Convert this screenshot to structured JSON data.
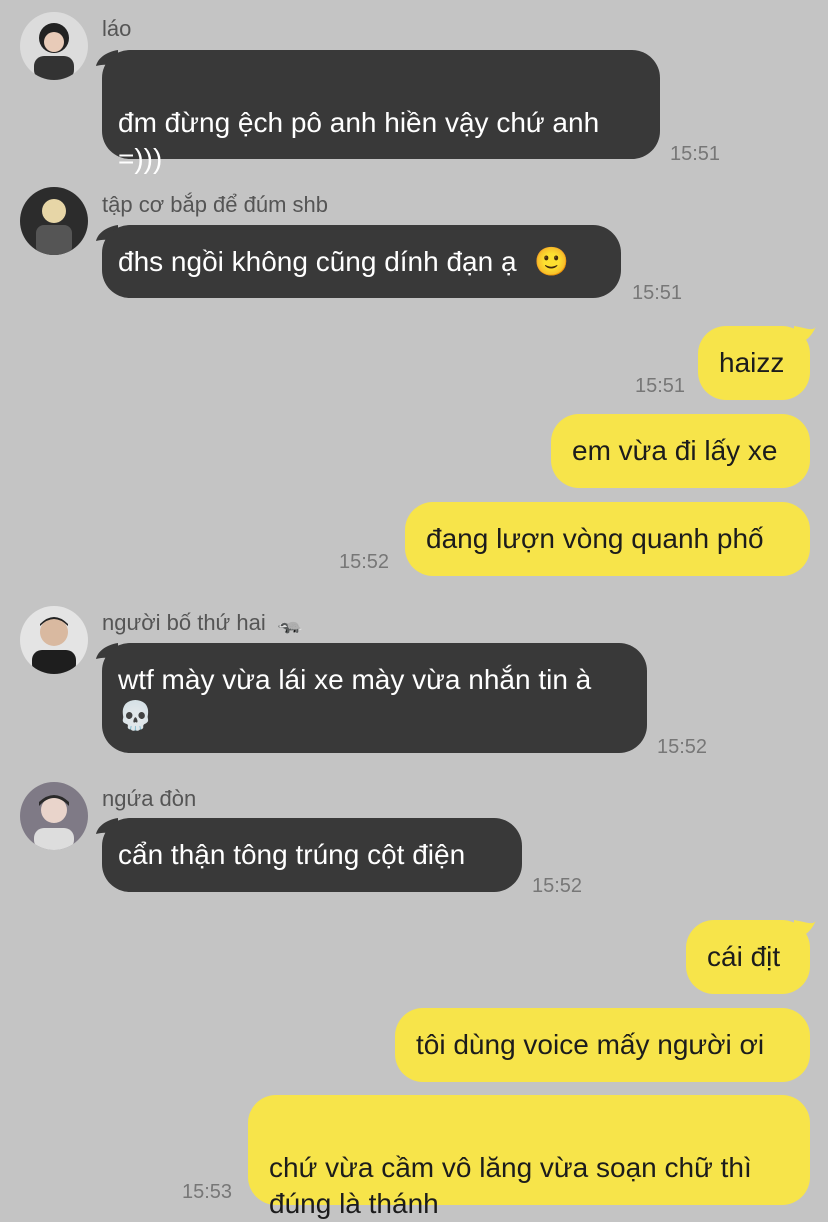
{
  "messages": [
    {
      "sender": "láo",
      "text": "đm đừng ệch pô anh hiền vậy chứ anh\n=)))",
      "time": "15:51",
      "avatar": "avatar-1"
    },
    {
      "sender": "tập cơ bắp để đúm shb",
      "text": "đhs ngồi không cũng dính đạn ạ",
      "emoji": "🙂",
      "time": "15:51",
      "avatar": "avatar-2"
    },
    {
      "text": "haizz",
      "time": "15:51"
    },
    {
      "text": "em vừa đi lấy xe"
    },
    {
      "text": "đang lượn vòng quanh phố",
      "time": "15:52"
    },
    {
      "sender": "người bố thứ hai",
      "sender_emoji": "🦡",
      "text": "wtf mày vừa lái xe mày vừa nhắn tin à",
      "emoji": "💀",
      "time": "15:52",
      "avatar": "avatar-3"
    },
    {
      "sender": "ngứa đòn",
      "text": "cẩn thận tông trúng cột điện",
      "time": "15:52",
      "avatar": "avatar-4"
    },
    {
      "text": "cái địt"
    },
    {
      "text": "tôi dùng voice mấy người ơi"
    },
    {
      "text": "chứ vừa cầm vô lăng vừa soạn chữ thì\nđúng là thánh",
      "time": "15:53"
    }
  ],
  "colors": {
    "background": "#c4c4c4",
    "incoming": "#393939",
    "outgoing": "#f7e44a"
  }
}
